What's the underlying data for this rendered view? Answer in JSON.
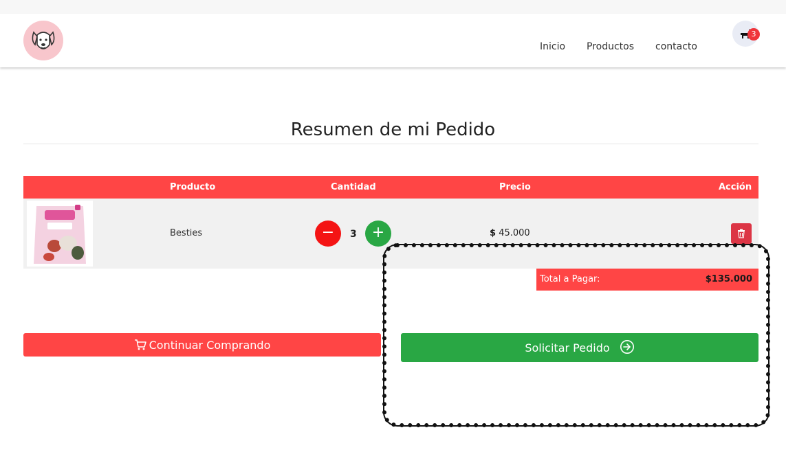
{
  "nav": {
    "links": [
      "Inicio",
      "Productos",
      "contacto"
    ],
    "cart_count": "3"
  },
  "page": {
    "title": "Resumen de mi Pedido"
  },
  "table": {
    "headers": [
      "Producto",
      "Cantidad",
      "Precio",
      "Acción"
    ],
    "rows": [
      {
        "product": "Besties",
        "quantity": "3",
        "price_currency": "$",
        "price_value": "45.000",
        "minus_label": "−",
        "plus_label": "+"
      }
    ]
  },
  "total": {
    "label": "Total a Pagar:",
    "value": "$135.000"
  },
  "buttons": {
    "continue_label": "Continuar Comprando",
    "order_label": "Solicitar Pedido"
  },
  "colors": {
    "brand_red": "#ff4545",
    "success_green": "#29a744",
    "danger": "#dc3545"
  },
  "icons": {
    "logo": "dog-face-icon",
    "cart": "dog-cart-icon",
    "trash": "trash-icon",
    "continue": "shopping-cart-icon",
    "order": "arrow-right-circle-icon"
  }
}
